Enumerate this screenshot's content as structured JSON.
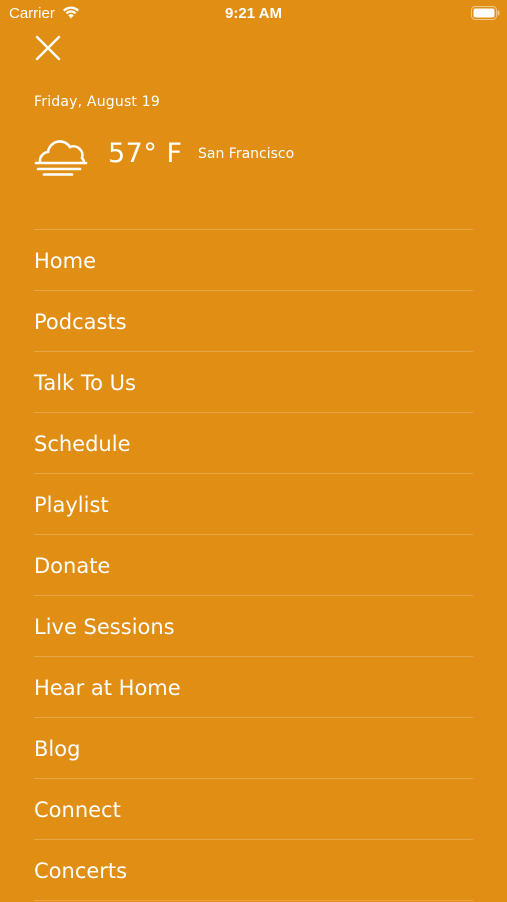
{
  "status_bar": {
    "carrier": "Carrier",
    "time": "9:21 AM",
    "wifi_icon": "wifi-icon",
    "battery_icon": "battery-icon"
  },
  "header": {
    "close_icon": "close-icon"
  },
  "weather": {
    "date": "Friday, August 19",
    "icon": "cloud-fog-icon",
    "temperature": "57° F",
    "city": "San Francisco"
  },
  "menu": {
    "items": [
      {
        "label": "Home"
      },
      {
        "label": "Podcasts"
      },
      {
        "label": "Talk To Us"
      },
      {
        "label": "Schedule"
      },
      {
        "label": "Playlist"
      },
      {
        "label": "Donate"
      },
      {
        "label": "Live Sessions"
      },
      {
        "label": "Hear at Home"
      },
      {
        "label": "Blog"
      },
      {
        "label": "Connect"
      },
      {
        "label": "Concerts"
      }
    ]
  },
  "colors": {
    "background": "#E08E14",
    "text": "#FFFFFF"
  }
}
